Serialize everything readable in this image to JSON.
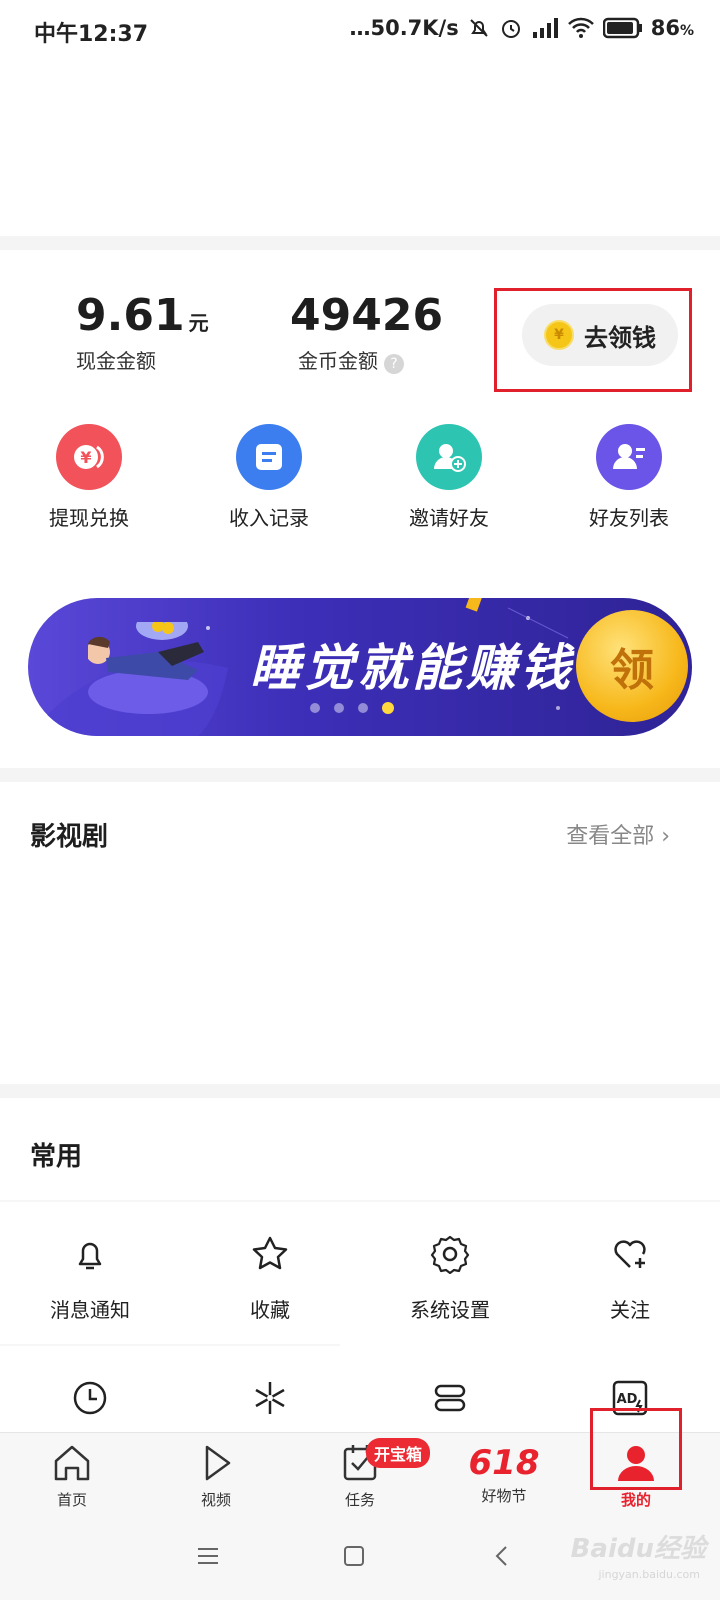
{
  "status_bar": {
    "time": "中午12:37",
    "network_speed": "…50.7K/s",
    "battery": "86",
    "battery_unit": "%"
  },
  "stats": {
    "cash_value": "9.61",
    "cash_unit": "元",
    "cash_label": "现金金额",
    "coin_value": "49426",
    "coin_label": "金币金额",
    "help_icon": "?",
    "claim_button": "去领钱",
    "claim_icon": "¥"
  },
  "quick_actions": [
    {
      "label": "提现兑换",
      "icon": "withdraw-icon",
      "color": "#f2525a",
      "glyph": "¥"
    },
    {
      "label": "收入记录",
      "icon": "record-icon",
      "color": "#3c7ef0",
      "glyph": ""
    },
    {
      "label": "邀请好友",
      "icon": "invite-friend-icon",
      "color": "#2ec4b2",
      "glyph": ""
    },
    {
      "label": "好友列表",
      "icon": "friend-list-icon",
      "color": "#6a55e8",
      "glyph": ""
    }
  ],
  "banner": {
    "title": "睡觉就能赚钱",
    "coin_text": "领"
  },
  "drama_section": {
    "title": "影视剧",
    "see_all": "查看全部 ›"
  },
  "common_section": {
    "title": "常用",
    "items": [
      {
        "label": "消息通知",
        "icon": "bell-icon"
      },
      {
        "label": "收藏",
        "icon": "star-icon"
      },
      {
        "label": "系统设置",
        "icon": "gear-icon"
      },
      {
        "label": "关注",
        "icon": "heart-plus-icon"
      }
    ],
    "row2_icons": [
      "clock-icon",
      "sparkle-icon",
      "card-stack-icon",
      "ad-icon"
    ]
  },
  "bottom_nav": {
    "items": [
      {
        "label": "首页",
        "icon": "home-icon"
      },
      {
        "label": "视频",
        "icon": "play-icon"
      },
      {
        "label": "任务",
        "icon": "task-icon"
      },
      {
        "label": "好物节",
        "icon": "618-icon",
        "glyph": "618"
      },
      {
        "label": "我的",
        "icon": "profile-icon"
      }
    ],
    "task_badge": "开宝箱",
    "accent": "#e8232e"
  },
  "watermark": {
    "brand": "Baidu经验",
    "url": "jingyan.baidu.com"
  }
}
